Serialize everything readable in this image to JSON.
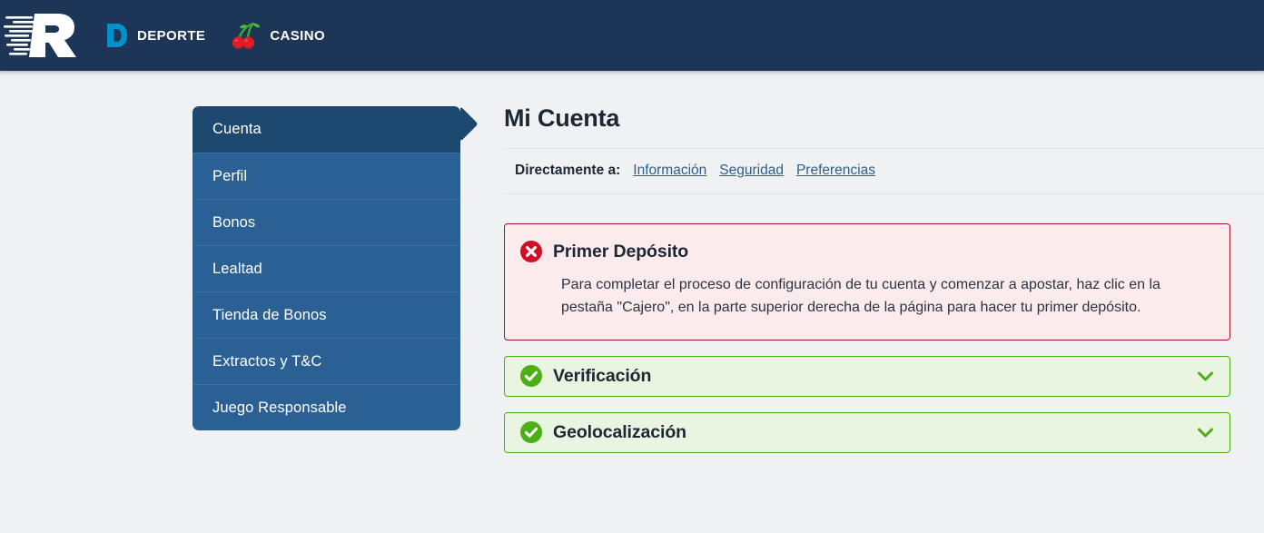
{
  "header": {
    "logo_name": "rushbet-r-logo",
    "tabs": [
      {
        "id": "deporte",
        "label": "DEPORTE",
        "icon": "deporte-d-icon",
        "icon_color": "#0091cd"
      },
      {
        "id": "casino",
        "label": "CASINO",
        "icon": "cherries-icon",
        "icon_color": "#e01b24"
      }
    ],
    "background_color": "#1d3557"
  },
  "sidebar": {
    "items": [
      {
        "label": "Cuenta",
        "active": true
      },
      {
        "label": "Perfil",
        "active": false
      },
      {
        "label": "Bonos",
        "active": false
      },
      {
        "label": "Lealtad",
        "active": false
      },
      {
        "label": "Tienda de Bonos",
        "active": false
      },
      {
        "label": "Extractos y T&C",
        "active": false
      },
      {
        "label": "Juego Responsable",
        "active": false
      }
    ],
    "active_color": "#1d4870",
    "item_color": "#2b6094"
  },
  "main": {
    "title": "Mi Cuenta",
    "jump": {
      "label": "Directamente a:",
      "links": [
        {
          "label": "Información"
        },
        {
          "label": "Seguridad"
        },
        {
          "label": "Preferencias"
        }
      ],
      "link_color": "#2e5f8a"
    },
    "panels": [
      {
        "id": "primer-deposito",
        "status": "error",
        "icon": "error-circle-x-icon",
        "title": "Primer Depósito",
        "body": "Para completar el proceso de configuración de tu cuenta y comenzar a apostar, haz clic en la pestaña \"Cajero\", en la parte superior derecha de la página para hacer tu primer depósito.",
        "border_color": "#a51426",
        "background_color": "#fcebec",
        "icon_color": "#d10f24"
      },
      {
        "id": "verificacion",
        "status": "success",
        "icon": "success-circle-check-icon",
        "title": "Verificación",
        "toggle_icon": "chevron-down-icon",
        "border_color": "#4caf16",
        "background_color": "#e9f5e1",
        "icon_color": "#4caf16"
      },
      {
        "id": "geolocalizacion",
        "status": "success",
        "icon": "success-circle-check-icon",
        "title": "Geolocalización",
        "toggle_icon": "chevron-down-icon",
        "border_color": "#4caf16",
        "background_color": "#e9f5e1",
        "icon_color": "#4caf16"
      }
    ],
    "partial_below": "…"
  }
}
